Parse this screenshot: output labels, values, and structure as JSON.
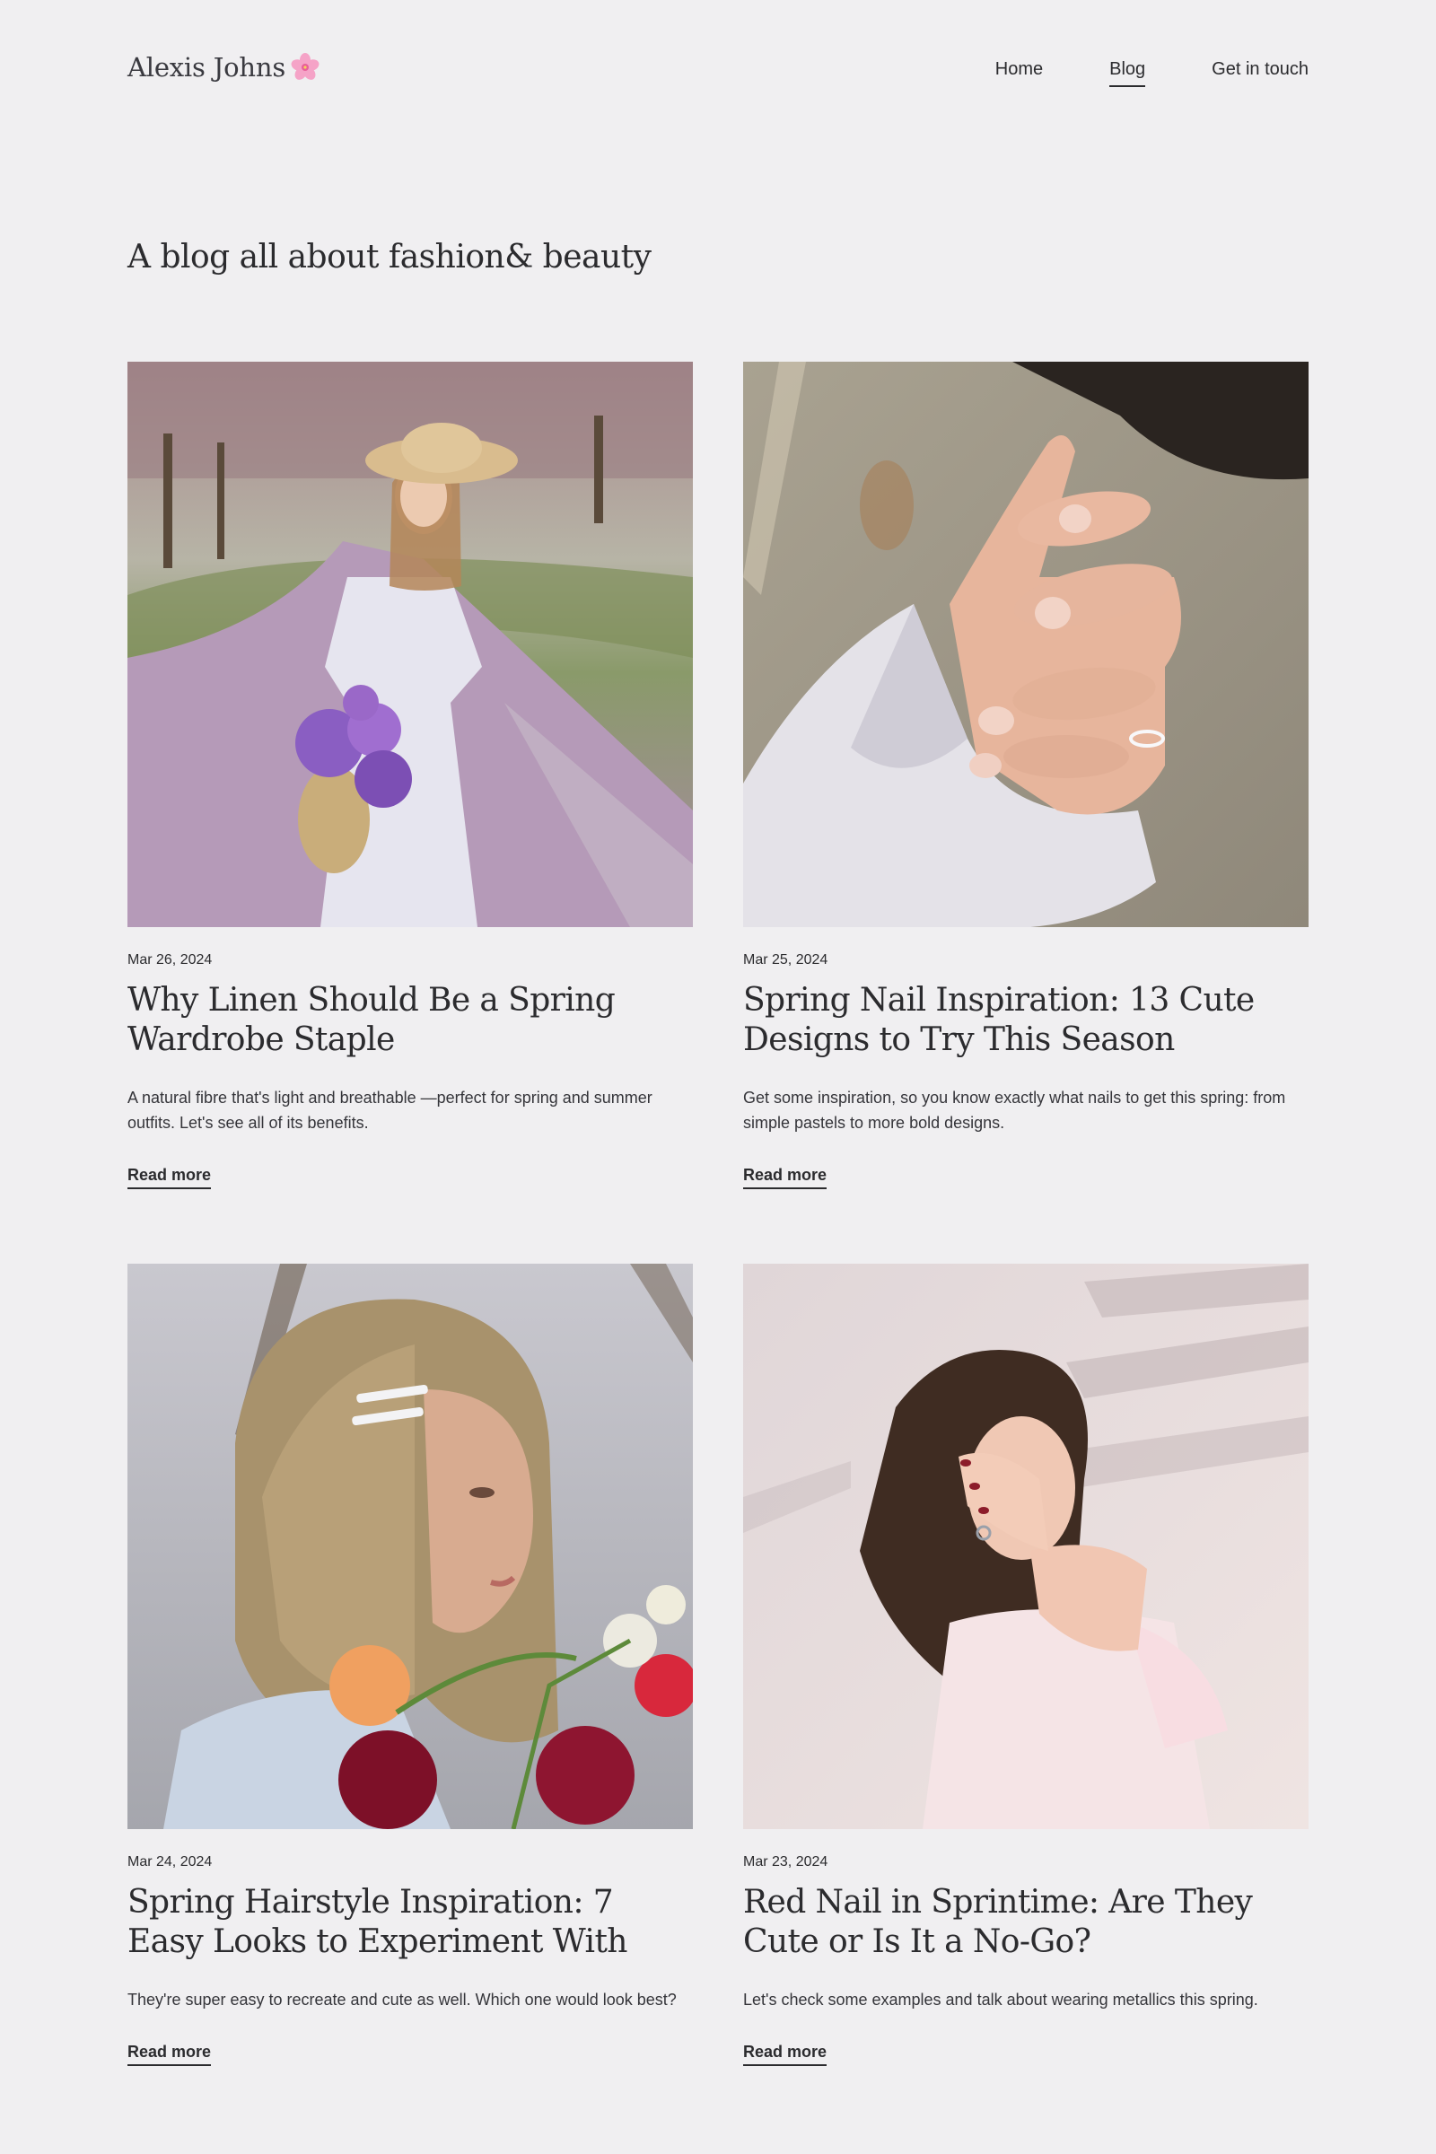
{
  "header": {
    "logo_text": "Alexis Johns",
    "logo_icon": "cherry-blossom-icon",
    "nav": [
      {
        "label": "Home",
        "active": false
      },
      {
        "label": "Blog",
        "active": true
      },
      {
        "label": "Get in touch",
        "active": false
      }
    ]
  },
  "intro": {
    "tagline": "A blog all about fashion& beauty"
  },
  "posts": [
    {
      "date": "Mar 26, 2024",
      "title": "Why Linen Should Be a Spring Wardrobe Staple",
      "excerpt": "A natural fibre that's light and breathable —perfect for spring and summer outfits. Let's see all of its benefits.",
      "cta": "Read more",
      "image": "woman-in-linen-dress-with-lilacs-photo"
    },
    {
      "date": "Mar 25, 2024",
      "title": "Spring Nail Inspiration: 13 Cute Designs to Try This Season",
      "excerpt": "Get some inspiration, so you know exactly what nails to get this spring: from simple pastels to more bold designs.",
      "cta": "Read more",
      "image": "hand-with-french-manicure-photo"
    },
    {
      "date": "Mar 24, 2024",
      "title": "Spring Hairstyle Inspiration: 7 Easy Looks to Experiment With",
      "excerpt": "They're super easy to recreate and cute as well. Which one would look best?",
      "cta": "Read more",
      "image": "woman-with-hair-clips-and-flowers-photo"
    },
    {
      "date": "Mar 23, 2024",
      "title": "Red Nail in Sprintime: Are They Cute or Is It a No-Go?",
      "excerpt": "Let's check some examples and talk about wearing metallics this spring.",
      "cta": "Read more",
      "image": "laughing-woman-with-red-nails-photo"
    }
  ],
  "colors": {
    "background": "#f0eff1",
    "text": "#2b2b2e"
  }
}
